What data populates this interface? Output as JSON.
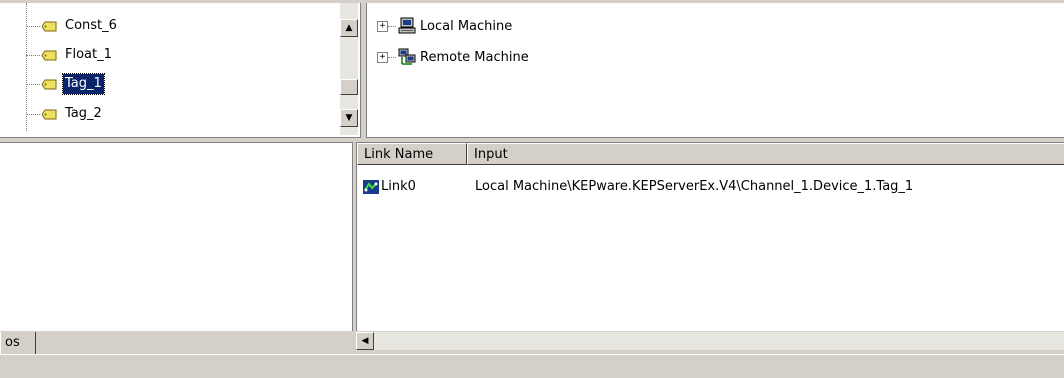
{
  "tag_tree": {
    "items": [
      {
        "label": "Const_6",
        "selected": false
      },
      {
        "label": "Float_1",
        "selected": false
      },
      {
        "label": "Tag_1",
        "selected": true
      },
      {
        "label": "Tag_2",
        "selected": false
      }
    ]
  },
  "machine_tree": {
    "items": [
      {
        "label": "Local Machine",
        "expander": "+",
        "icon": "computer-icon"
      },
      {
        "label": "Remote Machine",
        "expander": "+",
        "icon": "network-computer-icon"
      }
    ]
  },
  "list_view": {
    "columns": [
      "Link Name",
      "Input"
    ],
    "rows": [
      {
        "link_name": "Link0",
        "input": "Local Machine\\KEPware.KEPServerEx.V4\\Channel_1.Device_1.Tag_1",
        "icon": "link-icon"
      }
    ]
  },
  "lower_left": {
    "tab_label": "os"
  },
  "scrollbars": {
    "up_arrow": "▲",
    "down_arrow": "▼",
    "left_arrow": "◀"
  },
  "colors": {
    "selection": "#0a246a",
    "face": "#d4d0c8",
    "tag_yellow": "#f0e060"
  }
}
